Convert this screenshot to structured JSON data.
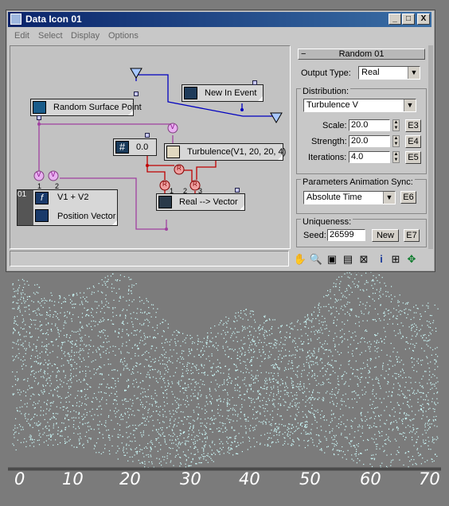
{
  "window": {
    "title": "Data Icon 01"
  },
  "window_buttons": {
    "minimize": "_",
    "maximize": "□",
    "close": "X"
  },
  "menu": [
    "Edit",
    "Select",
    "Display",
    "Options"
  ],
  "nodes": {
    "random_surface_point": "Random Surface Point",
    "new_in_event": "New In Event",
    "turbulence": "Turbulence(V1, 20, 20, 4)",
    "constant_value": "0.0",
    "real_to_vector": "Real --> Vector",
    "v1_plus_v2": "V1 + V2",
    "position_vector": "Position Vector",
    "row_index": "01"
  },
  "ports": {
    "v": "V",
    "r": "R",
    "p1": "1",
    "p2": "2",
    "p3": "3"
  },
  "panel": {
    "rollout_title": "Random 01",
    "output_type_label": "Output Type:",
    "output_type_value": "Real",
    "distribution_label": "Distribution:",
    "distribution_value": "Turbulence V",
    "scale_label": "Scale:",
    "scale_value": "20.0",
    "scale_btn": "E3",
    "strength_label": "Strength:",
    "strength_value": "20.0",
    "strength_btn": "E4",
    "iterations_label": "Iterations:",
    "iterations_value": "4.0",
    "iterations_btn": "E5",
    "anim_sync_label": "Parameters Animation Sync:",
    "anim_sync_value": "Absolute Time",
    "anim_sync_btn": "E6",
    "uniqueness_label": "Uniqueness:",
    "seed_label": "Seed:",
    "seed_value": "26599",
    "new_button": "New",
    "seed_btn": "E7"
  },
  "viewport_axis_labels": [
    "0",
    "10",
    "20",
    "30",
    "40",
    "50",
    "60",
    "70"
  ],
  "colors": {
    "title_bar": "#0a246a",
    "purple_wire": "#a040a0",
    "blue_wire": "#0000c0",
    "red_wire": "#c00000",
    "particles": "#cfffff"
  }
}
